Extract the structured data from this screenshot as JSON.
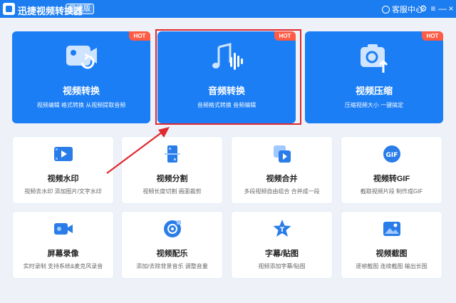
{
  "app": {
    "title": "迅捷视频转换器",
    "edition": "极速版",
    "service_label": "客服中心"
  },
  "window_controls": {
    "settings": "⚙",
    "menu": "≡",
    "minimize": "—",
    "close": "×"
  },
  "features": [
    {
      "title": "视频转换",
      "desc": "视频编辑 格式转换 从视频提取音频",
      "badge": "HOT",
      "icon": "video-convert-icon"
    },
    {
      "title": "音频转换",
      "desc": "音频格式转换  音频编辑",
      "badge": "HOT",
      "icon": "audio-convert-icon"
    },
    {
      "title": "视频压缩",
      "desc": "压缩视频大小  一键搞定",
      "badge": "HOT",
      "icon": "video-compress-icon"
    }
  ],
  "tools": [
    {
      "title": "视频水印",
      "desc": "视频去水印  添加图片/文字水印",
      "icon": "watermark-icon"
    },
    {
      "title": "视频分割",
      "desc": "视频长度切割  画面裁剪",
      "icon": "split-icon"
    },
    {
      "title": "视频合并",
      "desc": "多段视频自由组合  合并成一段",
      "icon": "merge-icon"
    },
    {
      "title": "视频转GIF",
      "desc": "截取视频片段  制作成GIF",
      "icon": "gif-icon"
    },
    {
      "title": "屏幕录像",
      "desc": "实时录制  支持系统&麦克风录音",
      "icon": "screen-record-icon"
    },
    {
      "title": "视频配乐",
      "desc": "添加/去除背景音乐  调整音量",
      "icon": "music-icon"
    },
    {
      "title": "字幕/贴图",
      "desc": "视频添加字幕/贴图",
      "icon": "subtitle-icon"
    },
    {
      "title": "视频截图",
      "desc": "逐帧截图  连续截图  输出长图",
      "icon": "screenshot-icon"
    }
  ],
  "colors": {
    "primary": "#1b7ef5",
    "titlebar": "#1c7df0",
    "hot": "#ff5a43",
    "highlight": "#e0282e",
    "background": "#eef2f8"
  }
}
